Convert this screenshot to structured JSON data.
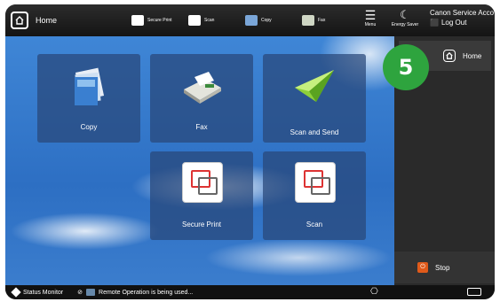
{
  "topbar": {
    "home_label": "Home",
    "quick_buttons": [
      {
        "label": "Secure Print",
        "icon": "secure-print-icon"
      },
      {
        "label": "Scan",
        "icon": "scan-icon"
      },
      {
        "label": "Copy",
        "icon": "copy-icon"
      },
      {
        "label": "Fax",
        "icon": "fax-icon"
      }
    ],
    "menu_label": "Menu",
    "energy_label": "Energy Saver",
    "user_name": "Canon Service Acco",
    "logout_label": "Log Out"
  },
  "tiles": [
    {
      "label": "Copy",
      "icon": "copy-icon"
    },
    {
      "label": "Fax",
      "icon": "fax-icon"
    },
    {
      "label": "Scan and Send",
      "icon": "scan-and-send-icon"
    },
    {
      "label": "Secure Print",
      "icon": "secure-print-icon"
    },
    {
      "label": "Scan",
      "icon": "scan-icon"
    }
  ],
  "right_panel": {
    "home_label": "Home",
    "badge_number": "5",
    "stop_label": "Stop"
  },
  "statusbar": {
    "status_monitor_label": "Status Monitor",
    "remote_text": "Remote Operation is being used..."
  },
  "colors": {
    "badge": "#2ea43e",
    "stop": "#e05a1a",
    "tile_bg": "#28467a"
  }
}
